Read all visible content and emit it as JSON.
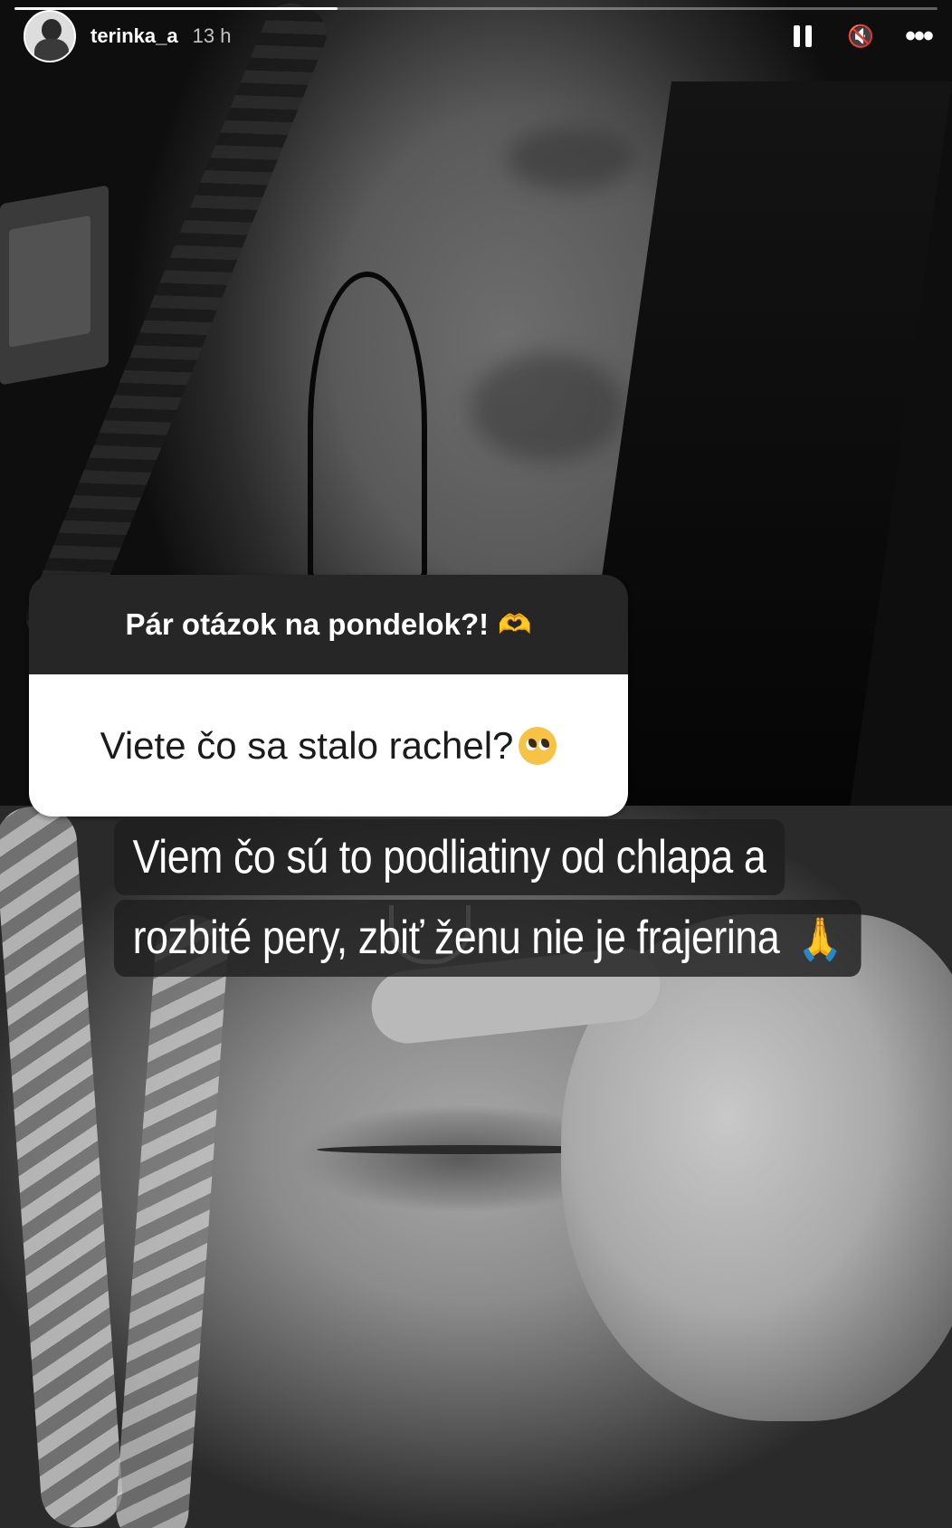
{
  "story": {
    "username": "terinka_a",
    "time_ago": "13 h",
    "progress": 0.35
  },
  "controls": {
    "pause_icon": "pause-icon",
    "mute_icon": "muted-speaker-icon",
    "more_icon": "more-options-icon",
    "mute_glyph": "🔇",
    "more_glyph": "•••"
  },
  "question_sticker": {
    "prompt": "Pár otázok na pondelok?!",
    "prompt_emoji": "🫶",
    "question": "Viete čo sa stalo rachel?",
    "question_emoji": "🥺"
  },
  "caption": {
    "line1": "Viem čo sú to podliatiny od chlapa a",
    "line2": "rozbité pery, zbiť ženu nie je frajerina",
    "emoji": "🙏"
  }
}
